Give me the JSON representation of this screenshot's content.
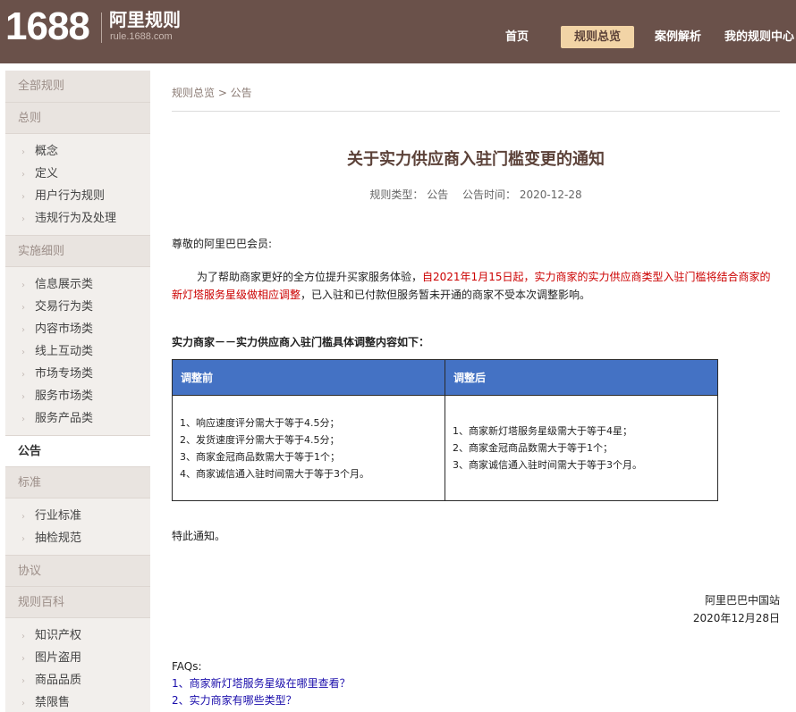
{
  "header": {
    "logo_number": "1688",
    "logo_title": "阿里规则",
    "logo_url": "rule.1688.com",
    "nav": [
      {
        "label": "首页"
      },
      {
        "label": "规则总览"
      },
      {
        "label": "案例解析"
      },
      {
        "label": "我的规则中心"
      }
    ],
    "active_color": "#f2d4a6",
    "bg_color": "#6a514a"
  },
  "sidebar": {
    "groups": [
      {
        "label": "全部规则",
        "items": []
      },
      {
        "label": "总则",
        "items": [
          "概念",
          "定义",
          "用户行为规则",
          "违规行为及处理"
        ]
      },
      {
        "label": "实施细则",
        "items": [
          "信息展示类",
          "交易行为类",
          "内容市场类",
          "线上互动类",
          "市场专场类",
          "服务市场类",
          "服务产品类"
        ]
      },
      {
        "label": "公告",
        "items": [],
        "current": true
      },
      {
        "label": "标准",
        "items": [
          "行业标准",
          "抽检规范"
        ]
      },
      {
        "label": "协议",
        "items": []
      },
      {
        "label": "规则百科",
        "items": [
          "知识产权",
          "图片盗用",
          "商品品质",
          "禁限售"
        ]
      }
    ]
  },
  "main": {
    "breadcrumb": "规则总览 > 公告",
    "title": "关于实力供应商入驻门槛变更的通知",
    "meta_type": "规则类型：  公告",
    "meta_time": "公告时间：  2020-12-28",
    "greeting": "尊敬的阿里巴巴会员:",
    "para_normal_1": "为了帮助商家更好的全方位提升买家服务体验，",
    "para_red": "自2021年1月15日起，实力商家的实力供应商类型入驻门槛将结合商家的新灯塔服务星级做相应调整",
    "para_normal_2": "，已入驻和已付款但服务暂未开通的商家不受本次调整影响。",
    "red_color": "#cc0000",
    "subhead": "实力商家－－实力供应商入驻门槛具体调整内容如下：",
    "table": {
      "header_before": "调整前",
      "header_after": "调整后",
      "header_color": "#4472c4",
      "before": [
        "1、响应速度评分需大于等于4.5分；",
        "2、发货速度评分需大于等于4.5分；",
        "3、商家金冠商品数需大于等于1个；",
        "4、商家诚信通入驻时间需大于等于3个月。"
      ],
      "after": [
        "1、商家新灯塔服务星级需大于等于4星；",
        "2、商家金冠商品数需大于等于1个；",
        "3、商家诚信通入驻时间需大于等于3个月。"
      ]
    },
    "closing": "特此通知。",
    "signature": "阿里巴巴中国站",
    "date": "2020年12月28日",
    "faq_label": "FAQs:",
    "faqs": [
      "1、商家新灯塔服务星级在哪里查看？",
      "2、实力商家有哪些类型？"
    ],
    "link_color": "#1a0dab"
  }
}
